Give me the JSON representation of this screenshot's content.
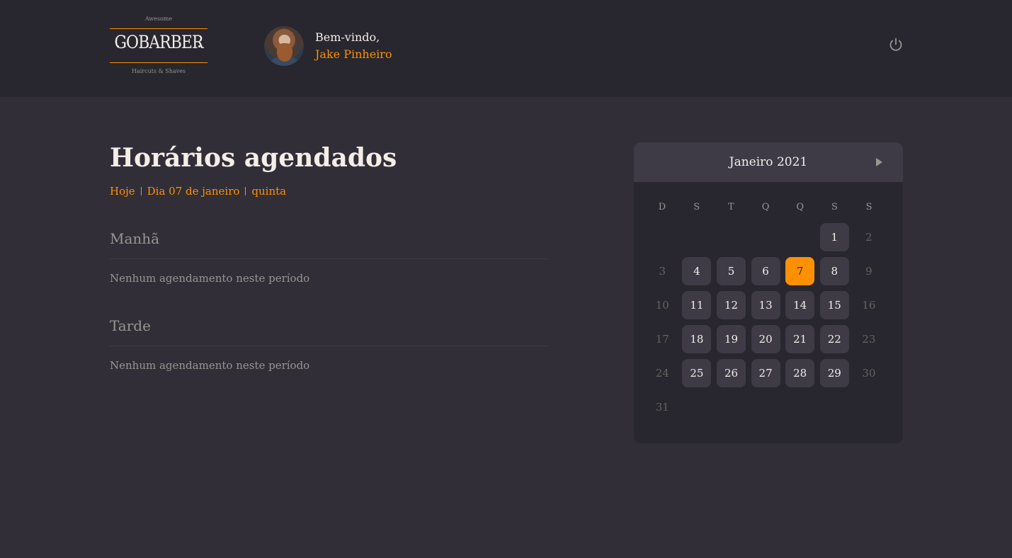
{
  "logo": {
    "top": "Awesome",
    "brand": "GOBARBER",
    "sub": "Haircuts & Shaves"
  },
  "profile": {
    "greeting": "Bem-vindo,",
    "name": "Jake Pinheiro"
  },
  "page": {
    "title": "Horários agendados",
    "today": "Hoje",
    "day": "Dia 07 de janeiro",
    "weekday": "quinta"
  },
  "sections": [
    {
      "title": "Manhã",
      "empty": "Nenhum agendamento neste período"
    },
    {
      "title": "Tarde",
      "empty": "Nenhum agendamento neste período"
    }
  ],
  "calendar": {
    "month": "Janeiro 2021",
    "weekdays": [
      "D",
      "S",
      "T",
      "Q",
      "Q",
      "S",
      "S"
    ],
    "weeks": [
      [
        [
          "",
          "empty"
        ],
        [
          "",
          "empty"
        ],
        [
          "",
          "empty"
        ],
        [
          "",
          "empty"
        ],
        [
          "",
          "empty"
        ],
        [
          "1",
          "avail"
        ],
        [
          "2",
          "dis"
        ]
      ],
      [
        [
          "3",
          "dis"
        ],
        [
          "4",
          "avail"
        ],
        [
          "5",
          "avail"
        ],
        [
          "6",
          "avail"
        ],
        [
          "7",
          "sel"
        ],
        [
          "8",
          "avail"
        ],
        [
          "9",
          "dis"
        ]
      ],
      [
        [
          "10",
          "dis"
        ],
        [
          "11",
          "avail"
        ],
        [
          "12",
          "avail"
        ],
        [
          "13",
          "avail"
        ],
        [
          "14",
          "avail"
        ],
        [
          "15",
          "avail"
        ],
        [
          "16",
          "dis"
        ]
      ],
      [
        [
          "17",
          "dis"
        ],
        [
          "18",
          "avail"
        ],
        [
          "19",
          "avail"
        ],
        [
          "20",
          "avail"
        ],
        [
          "21",
          "avail"
        ],
        [
          "22",
          "avail"
        ],
        [
          "23",
          "dis"
        ]
      ],
      [
        [
          "24",
          "dis"
        ],
        [
          "25",
          "avail"
        ],
        [
          "26",
          "avail"
        ],
        [
          "27",
          "avail"
        ],
        [
          "28",
          "avail"
        ],
        [
          "29",
          "avail"
        ],
        [
          "30",
          "dis"
        ]
      ],
      [
        [
          "31",
          "dis"
        ],
        [
          "",
          "empty"
        ],
        [
          "",
          "empty"
        ],
        [
          "",
          "empty"
        ],
        [
          "",
          "empty"
        ],
        [
          "",
          "empty"
        ],
        [
          "",
          "empty"
        ]
      ]
    ]
  },
  "colors": {
    "accent": "#ff9000",
    "background": "#312e38",
    "surface": "#28262e",
    "cell": "#3e3b47"
  },
  "icons": {
    "logout": "power-icon",
    "next_month": "arrow-right-icon"
  }
}
